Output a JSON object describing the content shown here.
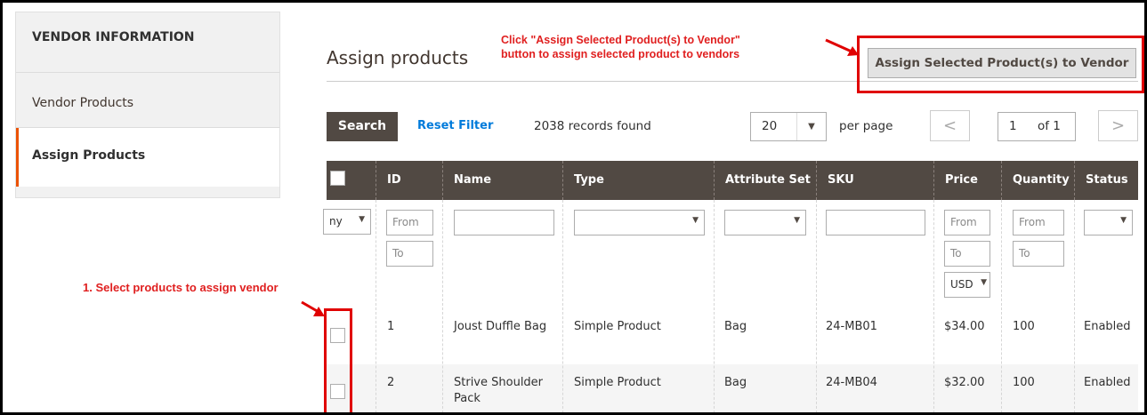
{
  "sidebar": {
    "title": "VENDOR INFORMATION",
    "items": [
      {
        "label": "Vendor Products"
      },
      {
        "label": "Assign Products"
      }
    ]
  },
  "page": {
    "title": "Assign products",
    "assign_button": "Assign Selected Product(s) to Vendor"
  },
  "annotations": {
    "top_line1": "Click \"Assign Selected Product(s) to Vendor\"",
    "top_line2": "button to assign selected product to vendors",
    "left": "1. Select products to assign vendor"
  },
  "toolbar": {
    "search_label": "Search",
    "reset_label": "Reset Filter",
    "records": "2038 records found",
    "per_page_value": "20",
    "per_page_label": "per page",
    "page_value": "1",
    "page_of": "of 1",
    "prev": "<",
    "next": ">"
  },
  "table": {
    "columns": [
      "ID",
      "Name",
      "Type",
      "Attribute Set",
      "SKU",
      "Price",
      "Quantity",
      "Status"
    ],
    "filters": {
      "any": "ny",
      "id_from": "From",
      "id_to": "To",
      "price_from": "From",
      "price_to": "To",
      "currency": "USD",
      "qty_from": "From",
      "qty_to": "To"
    },
    "rows": [
      {
        "id": "1",
        "name": "Joust Duffle Bag",
        "type": "Simple Product",
        "attribute_set": "Bag",
        "sku": "24-MB01",
        "price": "$34.00",
        "quantity": "100",
        "status": "Enabled"
      },
      {
        "id": "2",
        "name": "Strive Shoulder Pack",
        "type": "Simple Product",
        "attribute_set": "Bag",
        "sku": "24-MB04",
        "price": "$32.00",
        "quantity": "100",
        "status": "Enabled"
      }
    ]
  },
  "colors": {
    "annotation_red": "#e02020",
    "header_bg": "#514943",
    "accent_orange": "#eb5202",
    "link_blue": "#007bdb"
  }
}
